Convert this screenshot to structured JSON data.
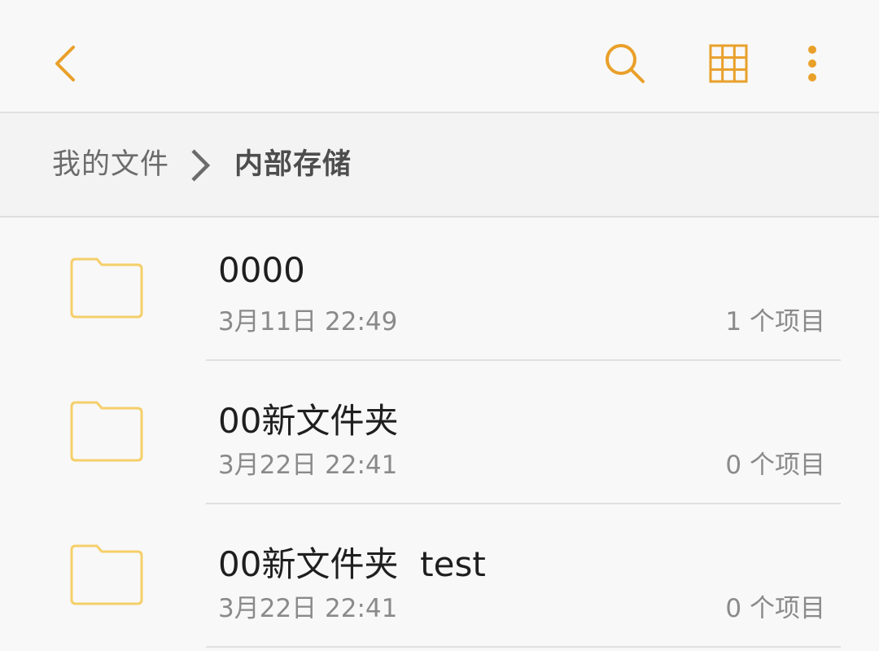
{
  "colors": {
    "accent": "#e9a02a",
    "folder": "#f5cf6a",
    "background": "#f8f8f8"
  },
  "toolbar": {
    "back_icon": "back-arrow-icon",
    "search_icon": "search-icon",
    "grid_icon": "grid-view-icon",
    "more_icon": "more-options-icon"
  },
  "breadcrumb": {
    "root": "我的文件",
    "separator_icon": "chevron-right-icon",
    "current": "内部存储"
  },
  "files": [
    {
      "name": "0000",
      "date": "3月11日 22:49",
      "count": "1 个项目",
      "icon": "folder-icon"
    },
    {
      "name": "00新文件夹",
      "date": "3月22日 22:41",
      "count": "0 个项目",
      "icon": "folder-icon"
    },
    {
      "name": "00新文件夹  test",
      "date": "3月22日 22:41",
      "count": "0 个项目",
      "icon": "folder-icon"
    }
  ]
}
